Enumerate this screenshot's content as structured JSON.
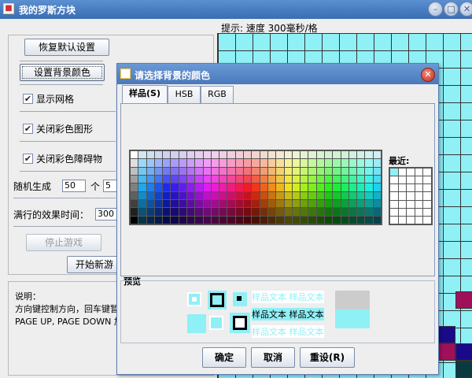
{
  "window": {
    "title": "我的罗斯方块",
    "min_icon": "minimize-icon",
    "max_icon": "maximize-icon",
    "close_icon": "close-icon"
  },
  "controls": {
    "restore_default": "恢复默认设置",
    "set_background": "设置背景颜色",
    "show_grid": "显示网格",
    "show_grid_checked": true,
    "disable_color_shapes": "关闭彩色图形",
    "disable_color_shapes_checked": true,
    "disable_color_obstacles": "关闭彩色障碍物",
    "disable_color_obstacles_checked": true,
    "random_label": "随机生成",
    "random_value_1": "50",
    "random_unit": "个",
    "random_value_2": "5",
    "line_effect_label": "满行的效果时间：",
    "line_effect_value": "300",
    "stop_game": "停止游戏",
    "start_game": "开始新游"
  },
  "info": {
    "heading": "说明：",
    "line1": "方向键控制方向，回车键暂",
    "line2": "PAGE UP, PAGE DOWN 加速"
  },
  "hint": "提示:   速度 300毫秒/格",
  "board": {
    "background": "#8ff0f6",
    "block_colors": [
      "#a0105a",
      "#1a0a8a",
      "#0a3a40"
    ]
  },
  "dialog": {
    "title": "请选择背景的颜色",
    "tabs": [
      "样品(S)",
      "HSB",
      "RGB"
    ],
    "recent_label": "最近:",
    "preview_label": "预览",
    "sample_text": "样品文本  样品文本",
    "sample_text_mid": "样品文本  样品文本",
    "ok": "确定",
    "cancel": "取消",
    "reset": "重设(R)",
    "selected_color": "#8ff0f6"
  }
}
